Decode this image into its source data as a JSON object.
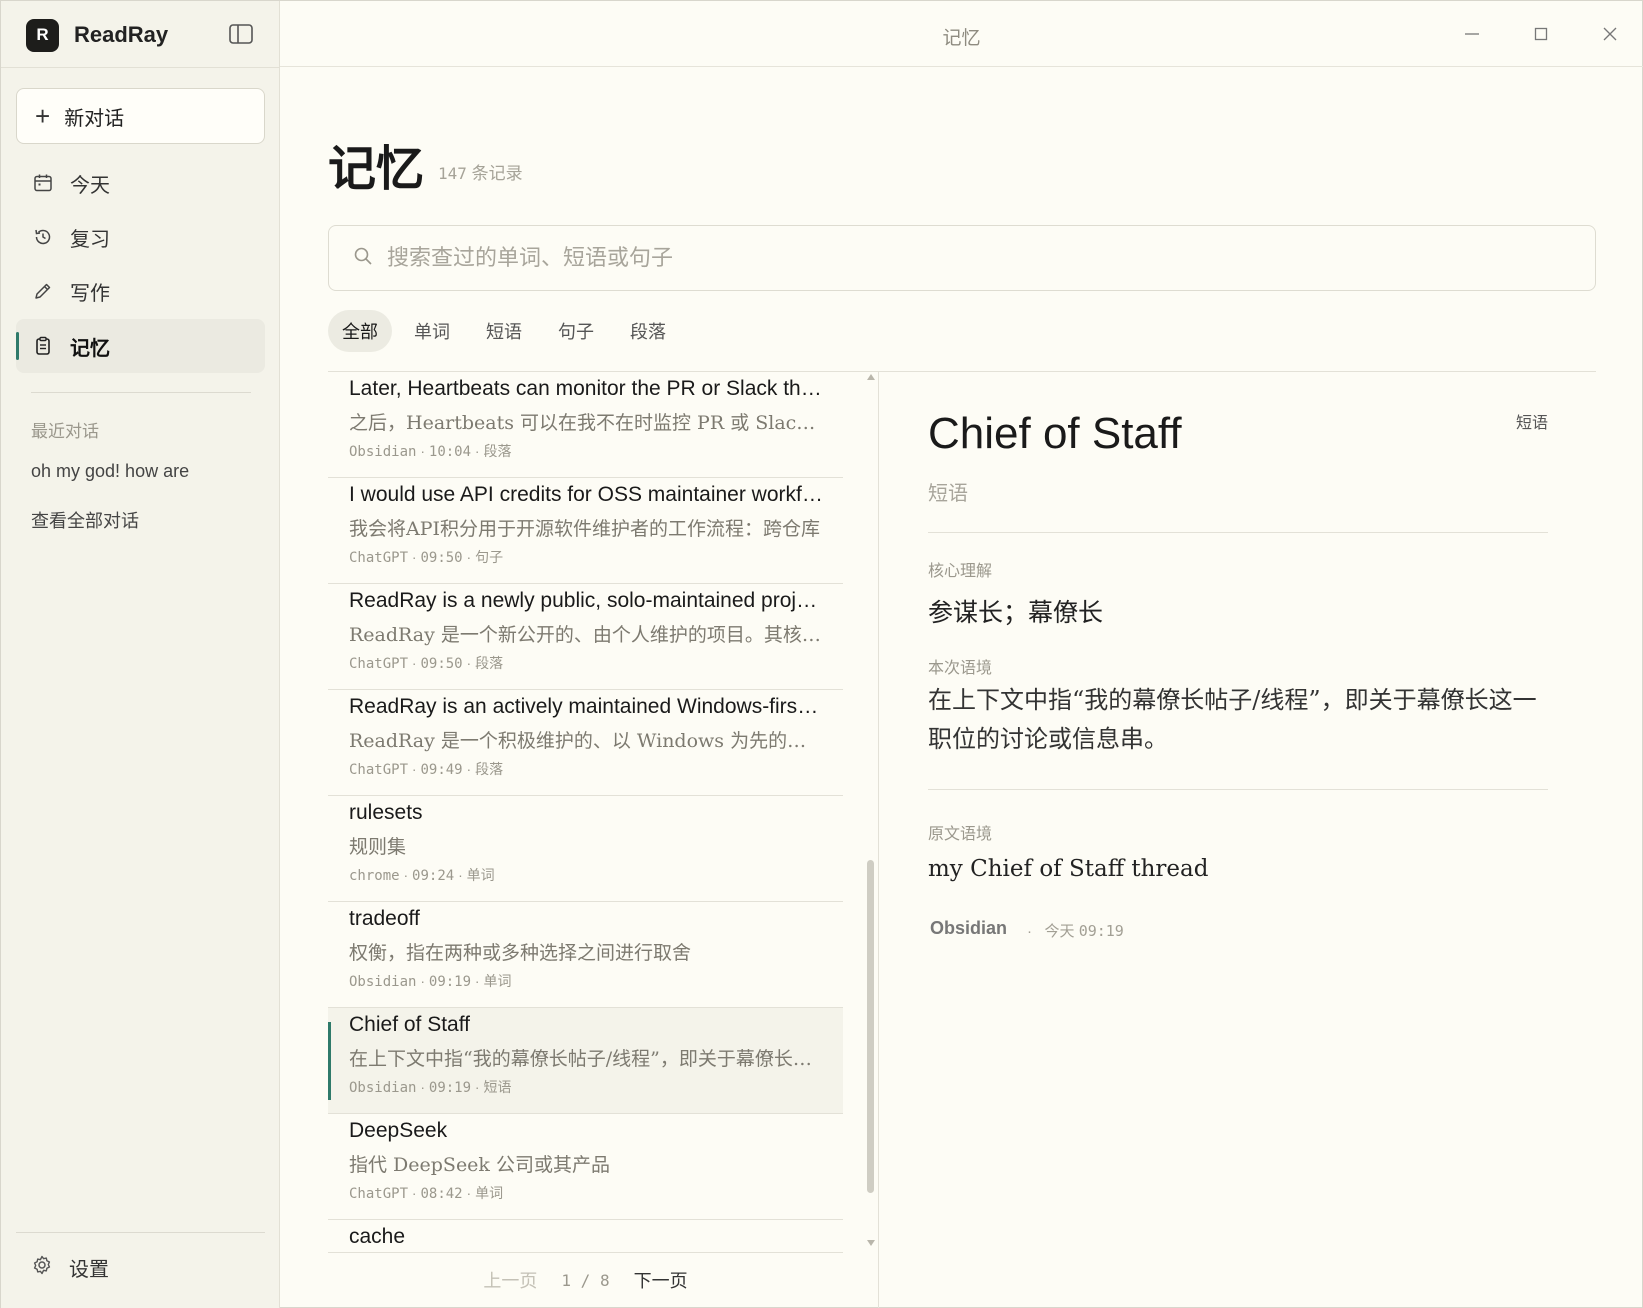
{
  "app": {
    "name": "ReadRay",
    "logo_letter": "R",
    "window_title": "记忆",
    "accent_color": "#2f7a6a"
  },
  "sidebar": {
    "new_chat_label": "新对话",
    "nav": [
      {
        "label": "今天",
        "icon": "calendar-icon"
      },
      {
        "label": "复习",
        "icon": "history-icon"
      },
      {
        "label": "写作",
        "icon": "pencil-icon"
      },
      {
        "label": "记忆",
        "icon": "clipboard-icon",
        "active": true
      }
    ],
    "recent_title": "最近对话",
    "recent": [
      "oh my god! how are",
      "查看全部对话"
    ],
    "settings_label": "设置"
  },
  "main": {
    "title": "记忆",
    "count_number": "147",
    "count_unit": "条记录",
    "search_placeholder": "搜索查过的单词、短语或句子",
    "filters": [
      "全部",
      "单词",
      "短语",
      "句子",
      "段落"
    ],
    "active_filter": "全部",
    "list": [
      {
        "title": "Later, Heartbeats can monitor the PR or Slack thread while I'm away",
        "translation": "之后，Heartbeats 可以在我不在时监控 PR 或 Slack 线程",
        "source": "Obsidian",
        "time": "10:04",
        "type": "段落"
      },
      {
        "title": "I would use API credits for OSS maintainer workflows",
        "translation": "我会将API积分用于开源软件维护者的工作流程：跨仓库",
        "source": "ChatGPT",
        "time": "09:50",
        "type": "句子"
      },
      {
        "title": "ReadRay is a newly public, solo-maintained project",
        "translation": "ReadRay 是一个新公开的、由个人维护的项目。其核心功能",
        "source": "ChatGPT",
        "time": "09:50",
        "type": "段落"
      },
      {
        "title": "ReadRay is an actively maintained Windows-first project",
        "translation": "ReadRay 是一个积极维护的、以 Windows 为先的开源项目",
        "source": "ChatGPT",
        "time": "09:49",
        "type": "段落"
      },
      {
        "title": "rulesets",
        "translation": "规则集",
        "source": "chrome",
        "time": "09:24",
        "type": "单词"
      },
      {
        "title": "tradeoff",
        "translation": "权衡，指在两种或多种选择之间进行取舍",
        "source": "Obsidian",
        "time": "09:19",
        "type": "单词"
      },
      {
        "title": "Chief of Staff",
        "translation": "在上下文中指“我的幕僚长帖子/线程”，即关于幕僚长这一职位",
        "source": "Obsidian",
        "time": "09:19",
        "type": "短语",
        "selected": true
      },
      {
        "title": "DeepSeek",
        "translation": "指代 DeepSeek 公司或其产品",
        "source": "ChatGPT",
        "time": "08:42",
        "type": "单词"
      },
      {
        "title": "cache",
        "translation": "",
        "source": "",
        "time": "",
        "type": ""
      }
    ],
    "pager": {
      "prev": "上一页",
      "current": "1",
      "total": "8",
      "next": "下一页"
    }
  },
  "detail": {
    "title": "Chief of Staff",
    "badge": "短语",
    "type": "短语",
    "core_label": "核心理解",
    "core": "参谋长；幕僚长",
    "context_label": "本次语境",
    "context": "在上下文中指“我的幕僚长帖子/线程”，即关于幕僚长这一职位的讨论或信息串。",
    "original_label": "原文语境",
    "original": "my Chief of Staff thread",
    "source": "Obsidian",
    "day": "今天",
    "time": "09:19"
  }
}
